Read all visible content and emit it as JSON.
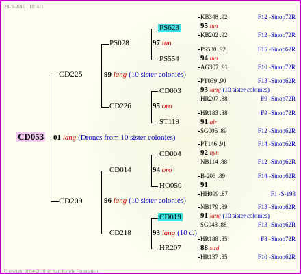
{
  "date": "28- 9-2010 ( 18: 41)",
  "copyright": "Copyright 2004-2010 @ Karl Kehrle Foundation.",
  "root": {
    "name": "CD053",
    "num": "01",
    "lang": "lang",
    "note": "(Drones from 10 sister colonies)"
  },
  "p1": {
    "name": "CD225",
    "num": "99",
    "lang": "lang",
    "note": "(10 sister colonies)"
  },
  "p2": {
    "name": "CD209",
    "num": "96",
    "lang": "lang",
    "note": "(10 sister colonies)"
  },
  "g1": {
    "name": "PS028",
    "num": "97",
    "lang": "tun"
  },
  "g2": {
    "name": "CD226",
    "num": "95",
    "lang": "oro"
  },
  "g3": {
    "name": "CD014",
    "num": "94",
    "lang": "oro"
  },
  "g4": {
    "name": "CD218",
    "num": "93",
    "lang": "lang",
    "note": "(10 c.)"
  },
  "gg": [
    "PS623",
    "PS554",
    "CD003",
    "ST119",
    "CD004",
    "HO050",
    "CD019",
    "HR207"
  ],
  "leaves": [
    {
      "a": "KB348 .92",
      "ar": "F12 -Sinop72R",
      "num": "95",
      "lang": "tun",
      "note": "",
      "b": "KB202 .92",
      "br": "F12 -Sinop72R"
    },
    {
      "a": "PS530 .92",
      "ar": "F15 -Sinop62R",
      "num": "94",
      "lang": "tun",
      "note": "",
      "b": "AG307 .91",
      "br": "F10 -Sinop72R"
    },
    {
      "a": "PT039 .90",
      "ar": "F13 -Sinop62R",
      "num": "93",
      "lang": "lang",
      "note": "(10 sister colonies)",
      "b": "HR207 .88",
      "br": "F9 -Sinop72R"
    },
    {
      "a": "HR183 .88",
      "ar": "F9 -Sinop72R",
      "num": "91",
      "lang": "alr",
      "note": "",
      "b": "SG006 .89",
      "br": "F12 -Sinop62R"
    },
    {
      "a": "PT146 .91",
      "ar": "F14 -Sinop62R",
      "num": "92",
      "lang": "nyn",
      "note": "",
      "b": "NB114 .88",
      "br": "F12 -Sinop62R"
    },
    {
      "a": "B-203 .89",
      "ar": "F14 -Sinop62R",
      "num": "91",
      "lang": "",
      "note": "",
      "b": "HH099 .87",
      "br": "F1 -S-193"
    },
    {
      "a": "NB179 .89",
      "ar": "F13 -Sinop62R",
      "num": "91",
      "lang": "lang",
      "note": "(10 sister colonies)",
      "b": "SG048 .88",
      "br": "F13 -Sinop62R"
    },
    {
      "a": "HR188 .85",
      "ar": "F8 -Sinop72R",
      "num": "88",
      "lang": "strd",
      "note": "",
      "b": "HR137 .85",
      "br": "F10 -Sinop62R"
    }
  ]
}
